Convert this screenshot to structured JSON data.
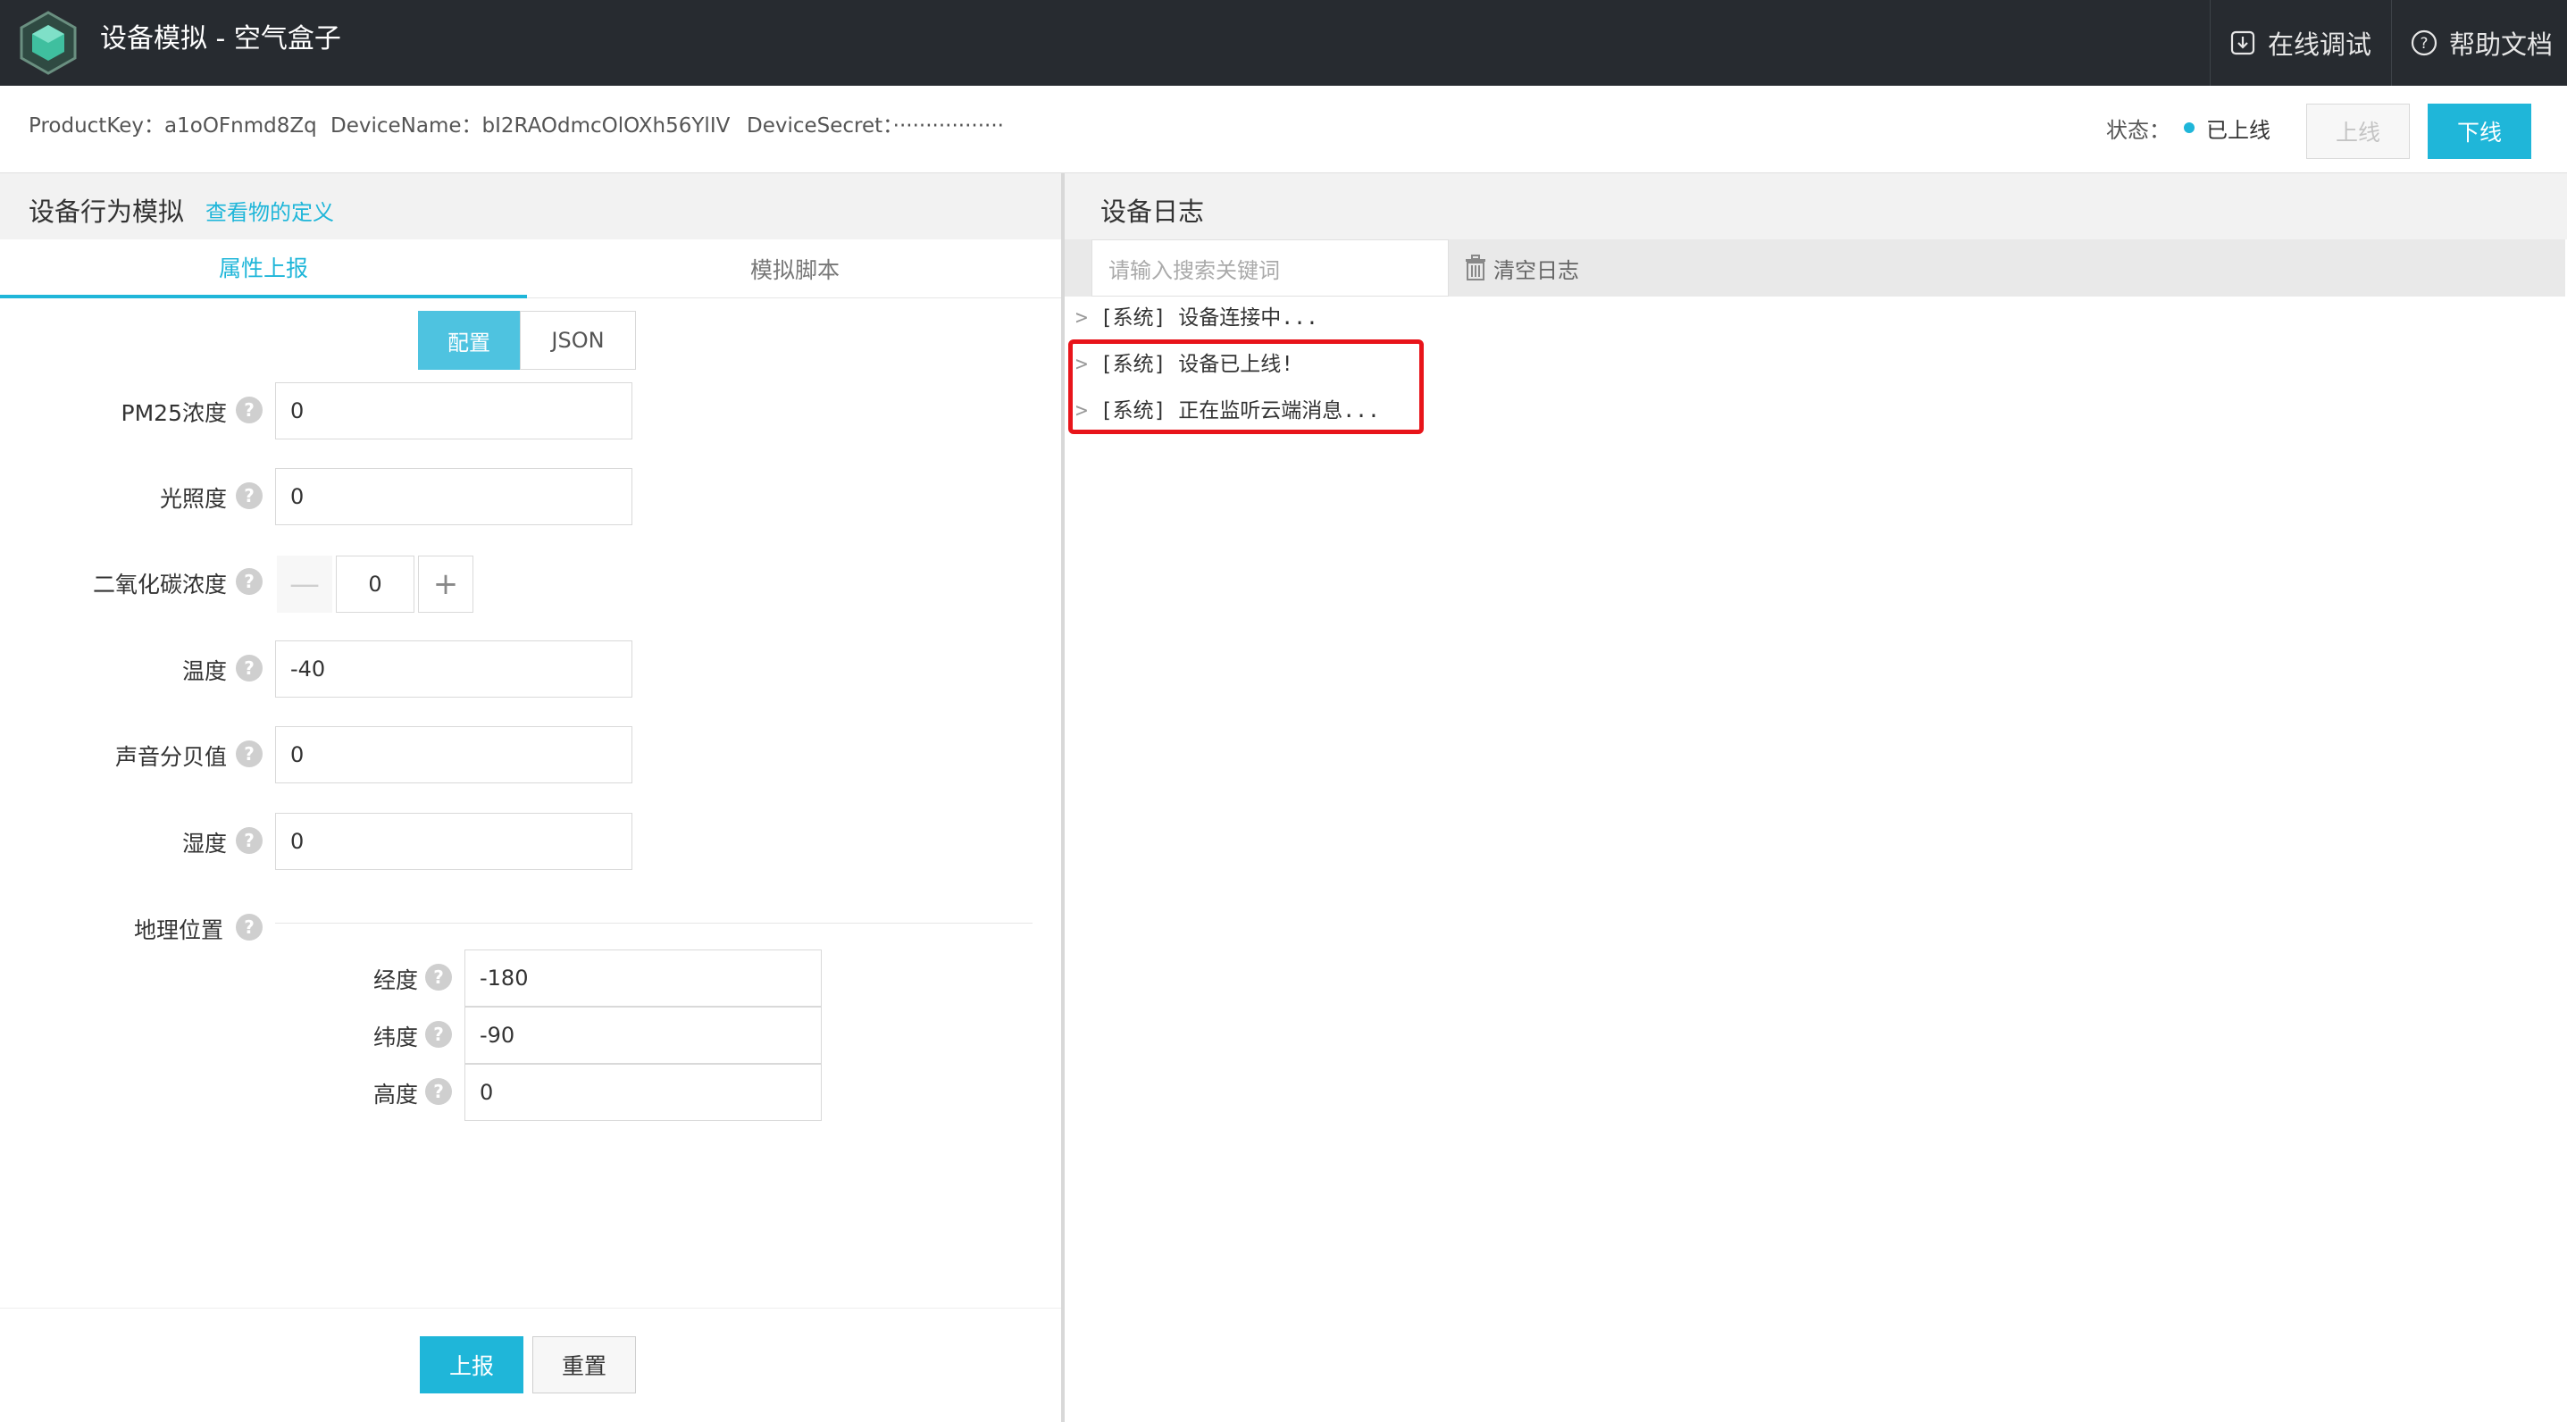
{
  "app": {
    "title": "设备模拟 - 空气盒子"
  },
  "top_actions": {
    "debug": "在线调试",
    "help": "帮助文档"
  },
  "device": {
    "product_key": "ProductKey：a1oOFnmd8Zq",
    "device_name": "DeviceName：bI2RAOdmcOlOXh56YlIV",
    "device_secret": "DeviceSecret：·················"
  },
  "status": {
    "label": "状态：",
    "value": "已上线",
    "color": "#1fb6d9"
  },
  "buttons": {
    "online": "上线",
    "offline": "下线",
    "report": "上报",
    "reset": "重置"
  },
  "left": {
    "title": "设备行为模拟",
    "link": "查看物的定义",
    "tabs": [
      "属性上报",
      "模拟脚本"
    ],
    "segments": [
      "配置",
      "JSON"
    ],
    "fields": [
      {
        "label": "PM25浓度",
        "value": "0"
      },
      {
        "label": "光照度",
        "value": "0"
      },
      {
        "label": "二氧化碳浓度",
        "value": "0"
      },
      {
        "label": "温度",
        "value": "-40"
      },
      {
        "label": "声音分贝值",
        "value": "0"
      },
      {
        "label": "湿度",
        "value": "0"
      }
    ],
    "geo": {
      "label": "地理位置",
      "fields": [
        {
          "label": "经度",
          "value": "-180"
        },
        {
          "label": "纬度",
          "value": "-90"
        },
        {
          "label": "高度",
          "value": "0"
        }
      ]
    },
    "help_mark": "?",
    "stepper": {
      "minus": "—",
      "plus": "+"
    }
  },
  "log": {
    "title": "设备日志",
    "search_placeholder": "请输入搜索关键词",
    "clear": "清空日志",
    "caret": ">",
    "lines": [
      "[系统] 设备连接中...",
      "[系统] 设备已上线!",
      "[系统] 正在监听云端消息..."
    ],
    "highlight_color": "#e8141a"
  }
}
